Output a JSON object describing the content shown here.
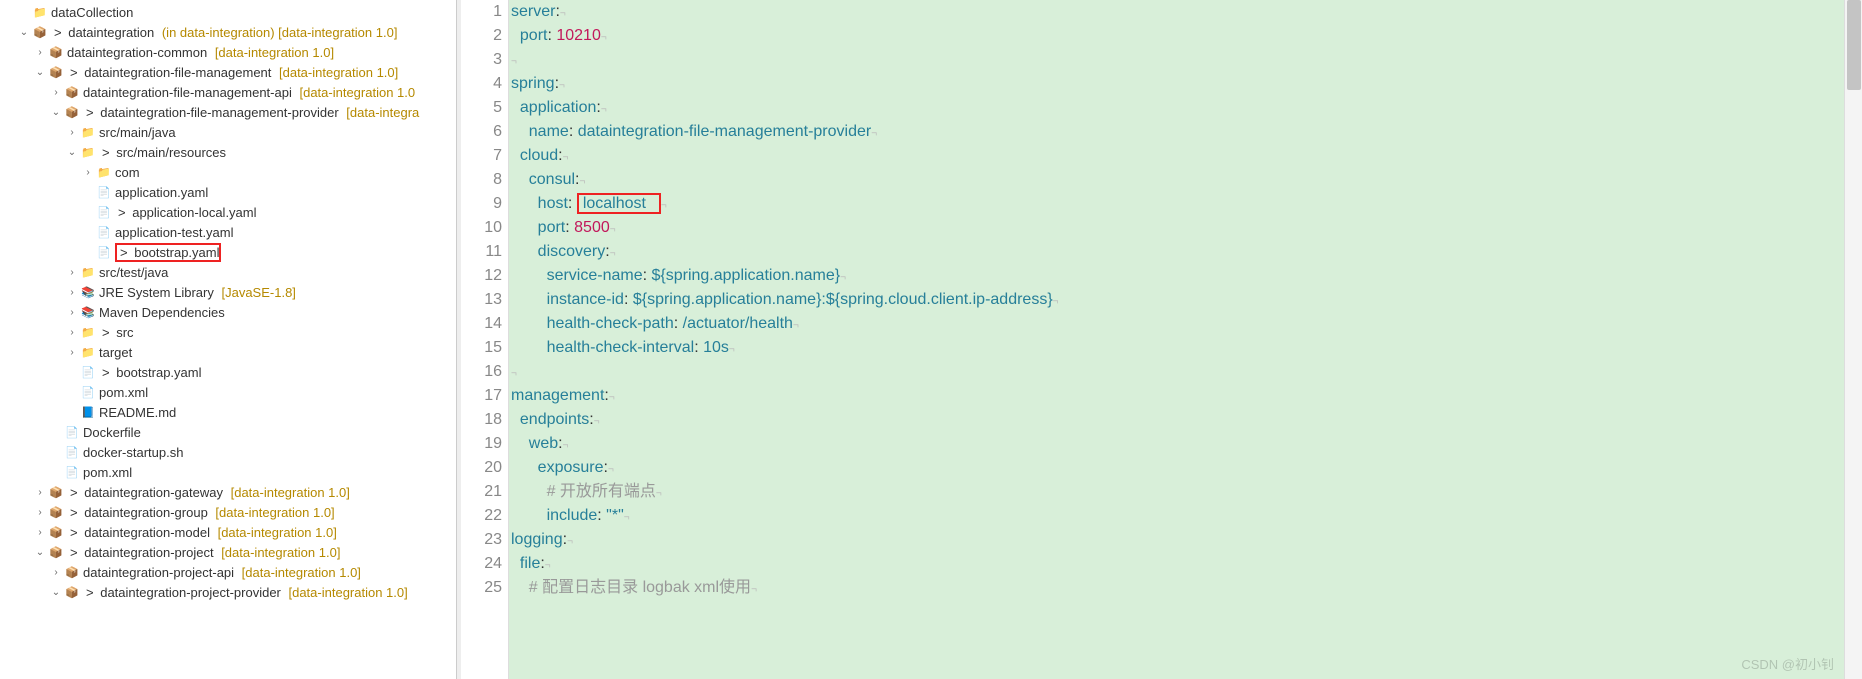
{
  "tree": [
    {
      "d": 1,
      "e": "",
      "i": "ic-prj",
      "pre": "",
      "name": "dataCollection",
      "suf": ""
    },
    {
      "d": 1,
      "e": "v",
      "i": "ic-mvn",
      "pre": "> ",
      "name": "dataintegration",
      "suf": " (in data-integration) [data-integration 1.0]"
    },
    {
      "d": 2,
      "e": ">",
      "i": "ic-mvn",
      "pre": "",
      "name": "dataintegration-common",
      "suf": " [data-integration 1.0]"
    },
    {
      "d": 2,
      "e": "v",
      "i": "ic-mvn",
      "pre": "> ",
      "name": "dataintegration-file-management",
      "suf": " [data-integration 1.0]"
    },
    {
      "d": 3,
      "e": ">",
      "i": "ic-mvn",
      "pre": "",
      "name": "dataintegration-file-management-api",
      "suf": " [data-integration 1.0"
    },
    {
      "d": 3,
      "e": "v",
      "i": "ic-mvn",
      "pre": "> ",
      "name": "dataintegration-file-management-provider",
      "suf": " [data-integra"
    },
    {
      "d": 4,
      "e": ">",
      "i": "ic-fld",
      "pre": "",
      "name": "src/main/java",
      "suf": ""
    },
    {
      "d": 4,
      "e": "v",
      "i": "ic-res",
      "pre": "> ",
      "name": "src/main/resources",
      "suf": ""
    },
    {
      "d": 5,
      "e": ">",
      "i": "ic-fld",
      "pre": "",
      "name": "com",
      "suf": ""
    },
    {
      "d": 5,
      "e": "",
      "i": "ic-yaml",
      "pre": "",
      "name": "application.yaml",
      "suf": ""
    },
    {
      "d": 5,
      "e": "",
      "i": "ic-yaml",
      "pre": "> ",
      "name": "application-local.yaml",
      "suf": ""
    },
    {
      "d": 5,
      "e": "",
      "i": "ic-yaml",
      "pre": "",
      "name": "application-test.yaml",
      "suf": ""
    },
    {
      "d": 5,
      "e": "",
      "i": "ic-yaml",
      "pre": "> ",
      "name": "bootstrap.yaml",
      "suf": "",
      "sel": true
    },
    {
      "d": 4,
      "e": ">",
      "i": "ic-fld",
      "pre": "",
      "name": "src/test/java",
      "suf": ""
    },
    {
      "d": 4,
      "e": ">",
      "i": "ic-lib",
      "pre": "",
      "name": "JRE System Library",
      "suf": " [JavaSE-1.8]"
    },
    {
      "d": 4,
      "e": ">",
      "i": "ic-lib",
      "pre": "",
      "name": "Maven Dependencies",
      "suf": ""
    },
    {
      "d": 4,
      "e": ">",
      "i": "ic-fld",
      "pre": "> ",
      "name": "src",
      "suf": ""
    },
    {
      "d": 4,
      "e": ">",
      "i": "ic-fld",
      "pre": "",
      "name": "target",
      "suf": ""
    },
    {
      "d": 4,
      "e": "",
      "i": "ic-yaml",
      "pre": "> ",
      "name": "bootstrap.yaml",
      "suf": ""
    },
    {
      "d": 4,
      "e": "",
      "i": "ic-xml",
      "pre": "",
      "name": "pom.xml",
      "suf": ""
    },
    {
      "d": 4,
      "e": "",
      "i": "ic-md",
      "pre": "",
      "name": "README.md",
      "suf": ""
    },
    {
      "d": 3,
      "e": "",
      "i": "ic-file",
      "pre": "",
      "name": "Dockerfile",
      "suf": ""
    },
    {
      "d": 3,
      "e": "",
      "i": "ic-file",
      "pre": "",
      "name": "docker-startup.sh",
      "suf": ""
    },
    {
      "d": 3,
      "e": "",
      "i": "ic-xml",
      "pre": "",
      "name": "pom.xml",
      "suf": ""
    },
    {
      "d": 2,
      "e": ">",
      "i": "ic-mvn",
      "pre": "> ",
      "name": "dataintegration-gateway",
      "suf": " [data-integration 1.0]"
    },
    {
      "d": 2,
      "e": ">",
      "i": "ic-mvn",
      "pre": "> ",
      "name": "dataintegration-group",
      "suf": " [data-integration 1.0]"
    },
    {
      "d": 2,
      "e": ">",
      "i": "ic-mvn",
      "pre": "> ",
      "name": "dataintegration-model",
      "suf": " [data-integration 1.0]"
    },
    {
      "d": 2,
      "e": "v",
      "i": "ic-mvn",
      "pre": "> ",
      "name": "dataintegration-project",
      "suf": " [data-integration 1.0]"
    },
    {
      "d": 3,
      "e": ">",
      "i": "ic-mvn",
      "pre": "",
      "name": "dataintegration-project-api",
      "suf": " [data-integration 1.0]"
    },
    {
      "d": 3,
      "e": "v",
      "i": "ic-mvn",
      "pre": "> ",
      "name": "dataintegration-project-provider",
      "suf": " [data-integration 1.0]"
    }
  ],
  "code": {
    "lines": [
      {
        "n": 1,
        "seg": [
          {
            "t": "server",
            "c": "kw"
          },
          {
            "t": ":",
            "c": ""
          }
        ]
      },
      {
        "n": 2,
        "seg": [
          {
            "t": "  ",
            "c": ""
          },
          {
            "t": "port",
            "c": "kw"
          },
          {
            "t": ": ",
            "c": ""
          },
          {
            "t": "10210",
            "c": "num"
          }
        ]
      },
      {
        "n": 3,
        "seg": []
      },
      {
        "n": 4,
        "seg": [
          {
            "t": "spring",
            "c": "kw"
          },
          {
            "t": ":",
            "c": ""
          }
        ]
      },
      {
        "n": 5,
        "seg": [
          {
            "t": "  ",
            "c": ""
          },
          {
            "t": "application",
            "c": "kw"
          },
          {
            "t": ":",
            "c": ""
          }
        ]
      },
      {
        "n": 6,
        "seg": [
          {
            "t": "    ",
            "c": ""
          },
          {
            "t": "name",
            "c": "kw"
          },
          {
            "t": ": ",
            "c": ""
          },
          {
            "t": "dataintegration-file-management-provider",
            "c": "str"
          }
        ]
      },
      {
        "n": 7,
        "seg": [
          {
            "t": "  ",
            "c": ""
          },
          {
            "t": "cloud",
            "c": "kw"
          },
          {
            "t": ":",
            "c": ""
          }
        ]
      },
      {
        "n": 8,
        "seg": [
          {
            "t": "    ",
            "c": ""
          },
          {
            "t": "consul",
            "c": "kw"
          },
          {
            "t": ":",
            "c": ""
          }
        ]
      },
      {
        "n": 9,
        "seg": [
          {
            "t": "      ",
            "c": ""
          },
          {
            "t": "host",
            "c": "kw"
          },
          {
            "t": ": ",
            "c": ""
          },
          {
            "t": "localhost  ",
            "c": "str",
            "hl": true
          }
        ]
      },
      {
        "n": 10,
        "seg": [
          {
            "t": "      ",
            "c": ""
          },
          {
            "t": "port",
            "c": "kw"
          },
          {
            "t": ": ",
            "c": ""
          },
          {
            "t": "8500",
            "c": "num"
          }
        ]
      },
      {
        "n": 11,
        "seg": [
          {
            "t": "      ",
            "c": ""
          },
          {
            "t": "discovery",
            "c": "kw"
          },
          {
            "t": ":",
            "c": ""
          }
        ]
      },
      {
        "n": 12,
        "seg": [
          {
            "t": "        ",
            "c": ""
          },
          {
            "t": "service-name",
            "c": "kw"
          },
          {
            "t": ": ",
            "c": ""
          },
          {
            "t": "${spring.application.name}",
            "c": "str"
          }
        ]
      },
      {
        "n": 13,
        "seg": [
          {
            "t": "        ",
            "c": ""
          },
          {
            "t": "instance-id",
            "c": "kw"
          },
          {
            "t": ": ",
            "c": ""
          },
          {
            "t": "${spring.application.name}:${spring.cloud.client.ip-address}",
            "c": "str"
          }
        ]
      },
      {
        "n": 14,
        "seg": [
          {
            "t": "        ",
            "c": ""
          },
          {
            "t": "health-check-path",
            "c": "kw"
          },
          {
            "t": ": ",
            "c": ""
          },
          {
            "t": "/actuator/health",
            "c": "str"
          }
        ]
      },
      {
        "n": 15,
        "seg": [
          {
            "t": "        ",
            "c": ""
          },
          {
            "t": "health-check-interval",
            "c": "kw"
          },
          {
            "t": ": ",
            "c": ""
          },
          {
            "t": "10s",
            "c": "str"
          }
        ]
      },
      {
        "n": 16,
        "seg": []
      },
      {
        "n": 17,
        "seg": [
          {
            "t": "management",
            "c": "kw"
          },
          {
            "t": ":",
            "c": ""
          }
        ]
      },
      {
        "n": 18,
        "seg": [
          {
            "t": "  ",
            "c": ""
          },
          {
            "t": "endpoints",
            "c": "kw"
          },
          {
            "t": ":",
            "c": ""
          }
        ]
      },
      {
        "n": 19,
        "seg": [
          {
            "t": "    ",
            "c": ""
          },
          {
            "t": "web",
            "c": "kw"
          },
          {
            "t": ":",
            "c": ""
          }
        ]
      },
      {
        "n": 20,
        "seg": [
          {
            "t": "      ",
            "c": ""
          },
          {
            "t": "exposure",
            "c": "kw"
          },
          {
            "t": ":",
            "c": ""
          }
        ]
      },
      {
        "n": 21,
        "seg": [
          {
            "t": "        ",
            "c": ""
          },
          {
            "t": "# 开放所有端点",
            "c": "comment"
          }
        ]
      },
      {
        "n": 22,
        "seg": [
          {
            "t": "        ",
            "c": ""
          },
          {
            "t": "include",
            "c": "kw"
          },
          {
            "t": ": ",
            "c": ""
          },
          {
            "t": "\"*\"",
            "c": "str"
          }
        ]
      },
      {
        "n": 23,
        "seg": [
          {
            "t": "logging",
            "c": "kw"
          },
          {
            "t": ":",
            "c": ""
          }
        ]
      },
      {
        "n": 24,
        "seg": [
          {
            "t": "  ",
            "c": ""
          },
          {
            "t": "file",
            "c": "kw"
          },
          {
            "t": ":",
            "c": ""
          }
        ]
      },
      {
        "n": 25,
        "seg": [
          {
            "t": "    ",
            "c": ""
          },
          {
            "t": "# 配置日志目录 logbak xml使用",
            "c": "comment"
          }
        ]
      }
    ]
  },
  "watermark": "CSDN @初小钊",
  "icons": {
    "ic-prj": "📁",
    "ic-mvn": "📦",
    "ic-fld": "📁",
    "ic-res": "📁",
    "ic-yaml": "📄",
    "ic-file": "📄",
    "ic-lib": "📚",
    "ic-xml": "📄",
    "ic-md": "📘"
  }
}
